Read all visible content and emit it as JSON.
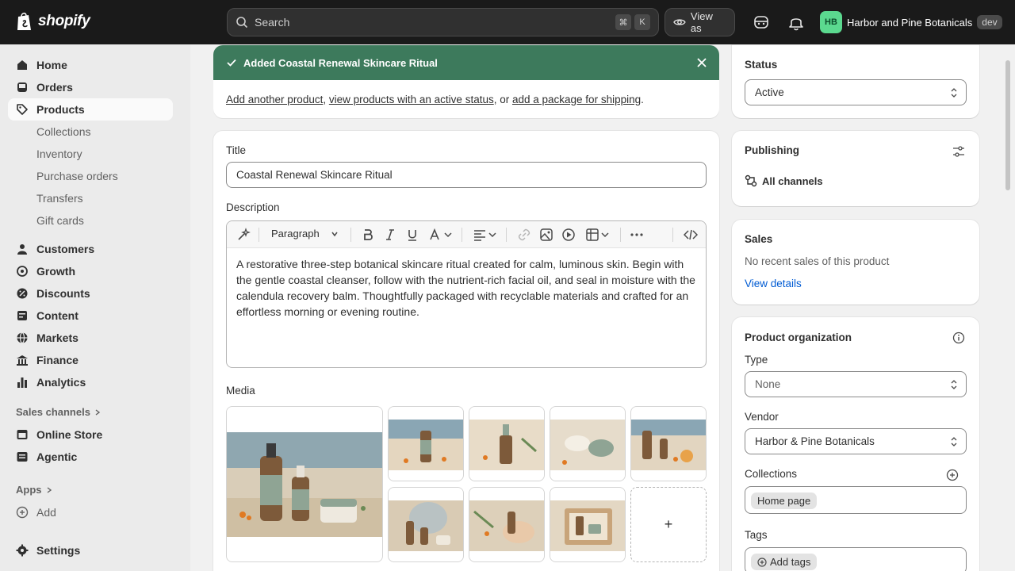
{
  "topbar": {
    "brand": "shopify",
    "search_placeholder": "Search",
    "search_kbd_1": "⌘",
    "search_kbd_2": "K",
    "view_as": "View as",
    "store_initials": "HB",
    "store_name": "Harbor and Pine Botanicals",
    "env_badge": "dev"
  },
  "sidebar": {
    "home": "Home",
    "orders": "Orders",
    "products": "Products",
    "products_sub": [
      "Collections",
      "Inventory",
      "Purchase orders",
      "Transfers",
      "Gift cards"
    ],
    "customers": "Customers",
    "growth": "Growth",
    "discounts": "Discounts",
    "content": "Content",
    "markets": "Markets",
    "finance": "Finance",
    "analytics": "Analytics",
    "sales_channels": "Sales channels",
    "online_store": "Online Store",
    "agentic": "Agentic",
    "apps": "Apps",
    "add": "Add",
    "settings": "Settings"
  },
  "banner": {
    "title": "Added Coastal Renewal Skincare Ritual",
    "link_1": "Add another product",
    "sep_1": ", ",
    "link_2": "view products with an active status",
    "sep_2": ", or ",
    "link_3": "add a package for shipping",
    "end": "."
  },
  "product": {
    "title_label": "Title",
    "title_value": "Coastal Renewal Skincare Ritual",
    "description_label": "Description",
    "paragraph_style": "Paragraph",
    "description": "A restorative three-step botanical skincare ritual created for calm, luminous skin. Begin with the gentle coastal cleanser, follow with the nutrient-rich facial oil, and seal in moisture with the calendula recovery balm. Thoughtfully packaged with recyclable materials and crafted for an effortless morning or evening routine.",
    "media_label": "Media",
    "media_add": "+"
  },
  "status": {
    "title": "Status",
    "value": "Active"
  },
  "publishing": {
    "title": "Publishing",
    "channels": "All channels"
  },
  "sales": {
    "title": "Sales",
    "empty": "No recent sales of this product",
    "link": "View details"
  },
  "organization": {
    "title": "Product organization",
    "type_label": "Type",
    "type_value": "None",
    "vendor_label": "Vendor",
    "vendor_value": "Harbor & Pine Botanicals",
    "collections_label": "Collections",
    "collection_chip": "Home page",
    "tags_label": "Tags",
    "tags_add": "Add tags"
  },
  "colors": {
    "banner_green": "#3d7a5c",
    "link_blue": "#005bd3",
    "avatar_green": "#5bd98f"
  }
}
